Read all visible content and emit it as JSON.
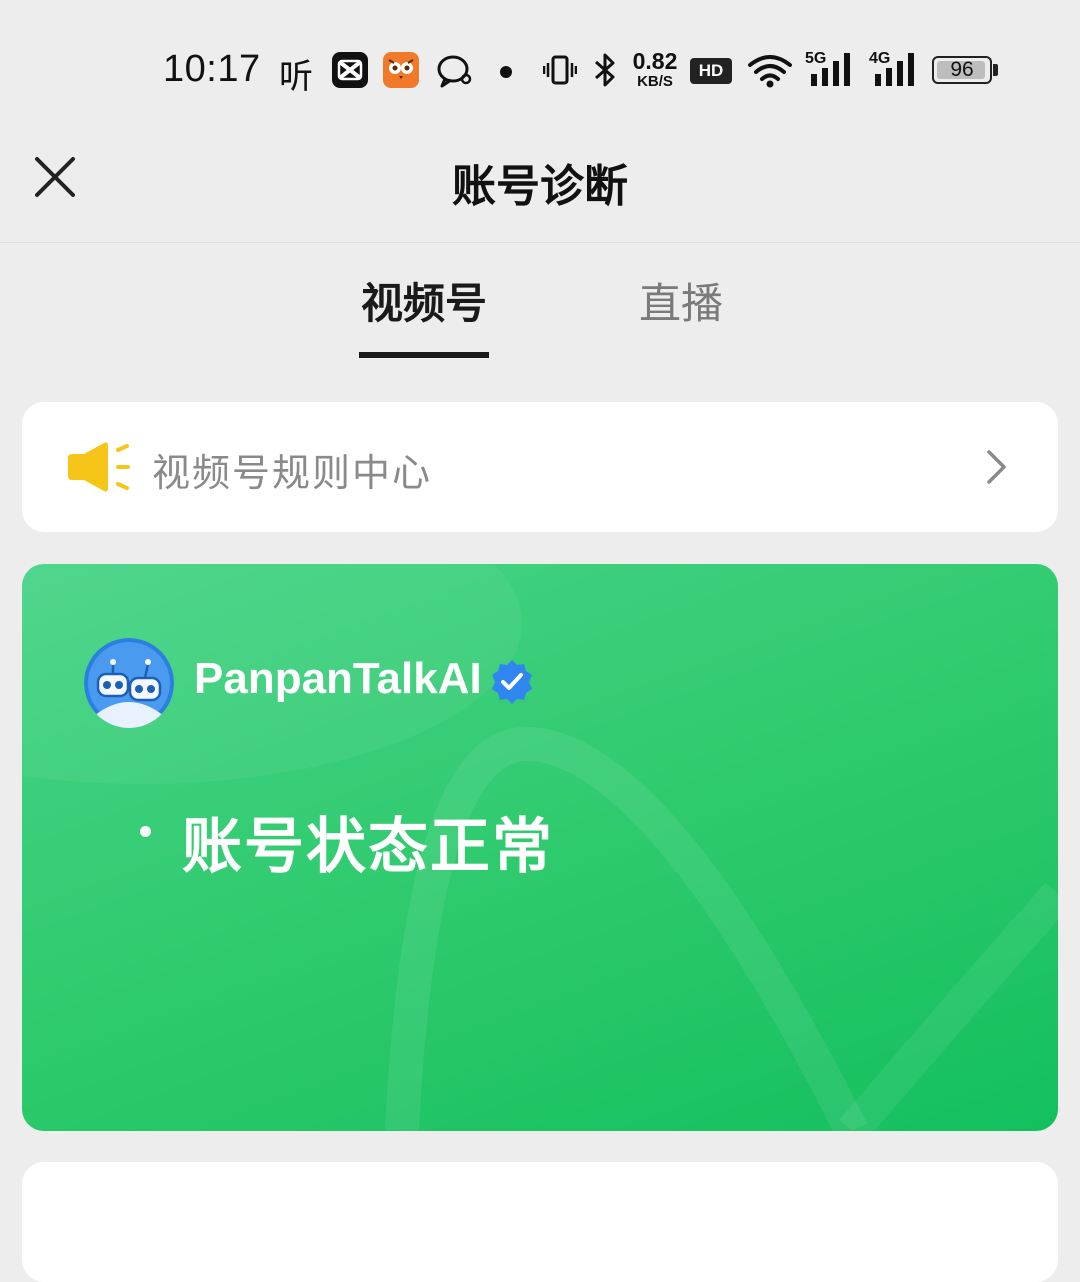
{
  "status_bar": {
    "time": "10:17",
    "ting_glyph": "听",
    "app_icons": [
      "capcut-icon",
      "owl-app-icon",
      "chat-bubble-icon"
    ],
    "speed_value": "0.82",
    "speed_unit": "KB/S",
    "hd_label": "HD",
    "net1": "5G",
    "net2": "4G",
    "battery": "96"
  },
  "nav": {
    "title": "账号诊断"
  },
  "tabs": [
    {
      "label": "视频号",
      "active": true
    },
    {
      "label": "直播",
      "active": false
    }
  ],
  "rules": {
    "label": "视频号规则中心",
    "icon": "megaphone-icon",
    "accent": "#f5c518"
  },
  "account": {
    "name": "PanpanTalkAI",
    "verified": true,
    "status": "账号状态正常",
    "card_color": "#2fca6e"
  }
}
